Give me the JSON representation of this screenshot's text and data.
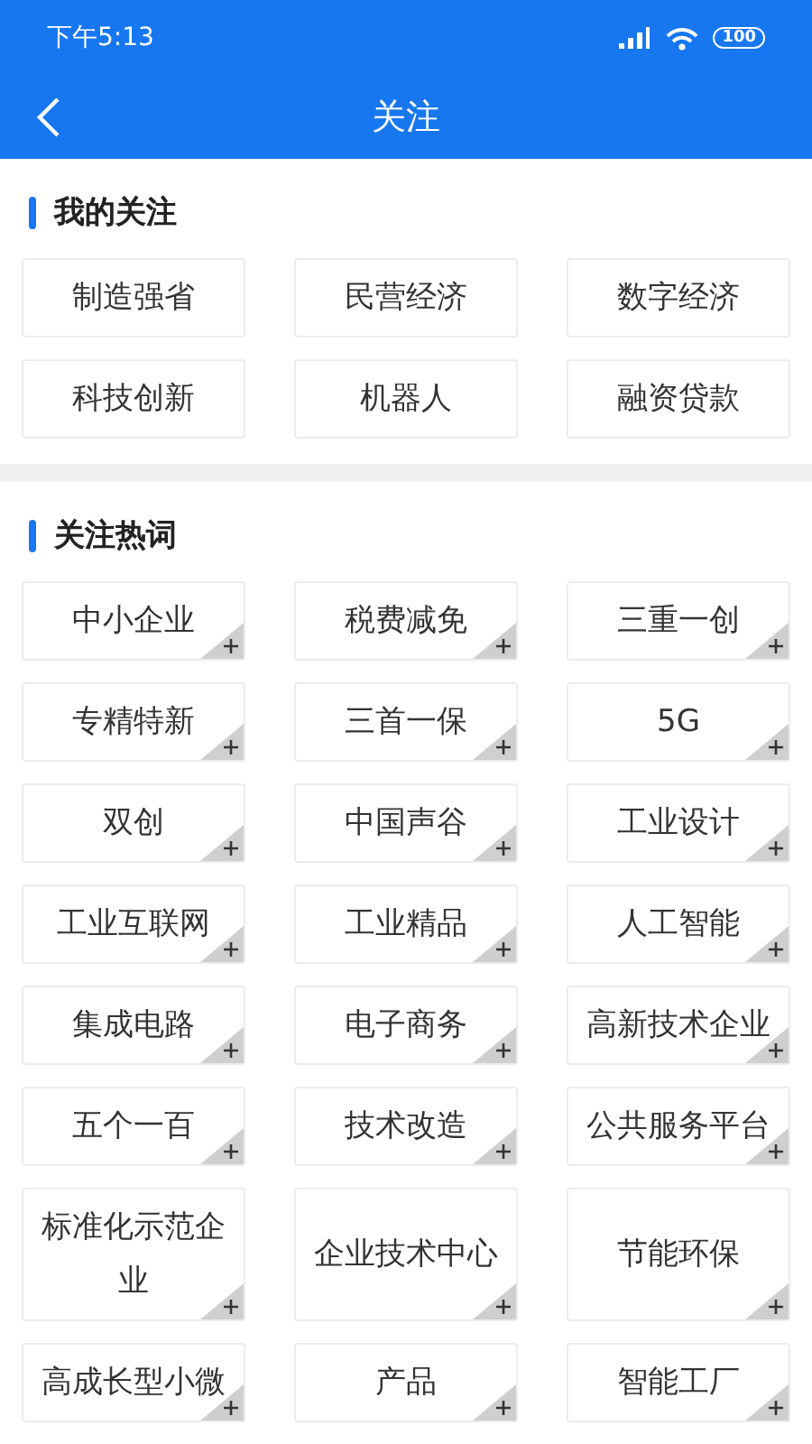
{
  "status_bar": {
    "time": "下午5:13",
    "battery": "100"
  },
  "nav": {
    "title": "关注"
  },
  "sections": [
    {
      "title": "我的关注",
      "addable": false,
      "tags": [
        "制造强省",
        "民营经济",
        "数字经济",
        "科技创新",
        "机器人",
        "融资贷款"
      ]
    },
    {
      "title": "关注热词",
      "addable": true,
      "tags": [
        "中小企业",
        "税费减免",
        "三重一创",
        "专精特新",
        "三首一保",
        "5G",
        "双创",
        "中国声谷",
        "工业设计",
        "工业互联网",
        "工业精品",
        "人工智能",
        "集成电路",
        "电子商务",
        "高新技术企业",
        "五个一百",
        "技术改造",
        "公共服务平台",
        "标准化示范企业",
        "企业技术中心",
        "节能环保",
        "高成长型小微",
        "产品",
        "智能工厂"
      ]
    }
  ]
}
